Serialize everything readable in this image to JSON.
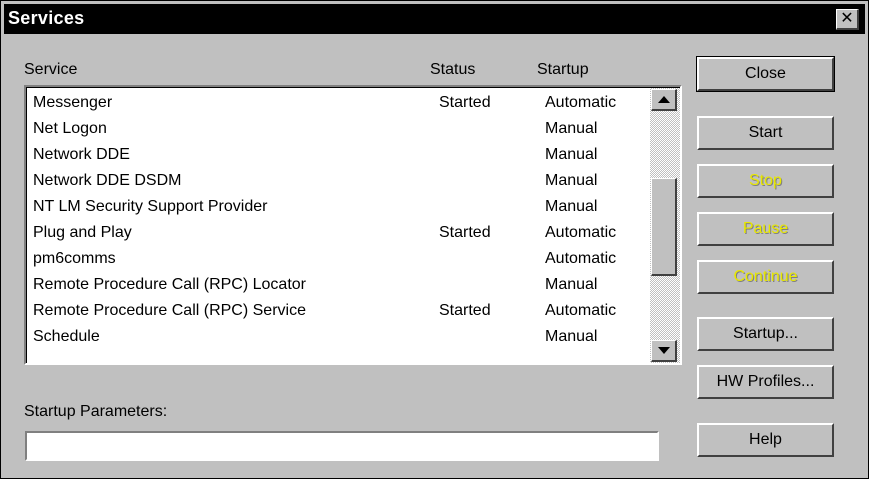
{
  "window": {
    "title": "Services",
    "close_glyph": "✕"
  },
  "columns": {
    "service": "Service",
    "status": "Status",
    "startup": "Startup"
  },
  "services": [
    {
      "name": "Messenger",
      "status": "Started",
      "startup": "Automatic"
    },
    {
      "name": "Net Logon",
      "status": "",
      "startup": "Manual"
    },
    {
      "name": "Network DDE",
      "status": "",
      "startup": "Manual"
    },
    {
      "name": "Network DDE DSDM",
      "status": "",
      "startup": "Manual"
    },
    {
      "name": "NT LM Security Support Provider",
      "status": "",
      "startup": "Manual"
    },
    {
      "name": "Plug and Play",
      "status": "Started",
      "startup": "Automatic"
    },
    {
      "name": "pm6comms",
      "status": "",
      "startup": "Automatic"
    },
    {
      "name": "Remote Procedure Call (RPC) Locator",
      "status": "",
      "startup": "Manual"
    },
    {
      "name": "Remote Procedure Call (RPC) Service",
      "status": "Started",
      "startup": "Automatic"
    },
    {
      "name": "Schedule",
      "status": "",
      "startup": "Manual"
    }
  ],
  "buttons": {
    "close": "Close",
    "start": "Start",
    "stop": "Stop",
    "pause": "Pause",
    "continue": "Continue",
    "startup": "Startup...",
    "hw_profiles": "HW Profiles...",
    "help": "Help"
  },
  "startup_parameters": {
    "label": "Startup Parameters:",
    "value": ""
  },
  "colors": {
    "titlebar": "#000000",
    "face": "#c0c0c0",
    "disabled_text": "#e8e800"
  }
}
